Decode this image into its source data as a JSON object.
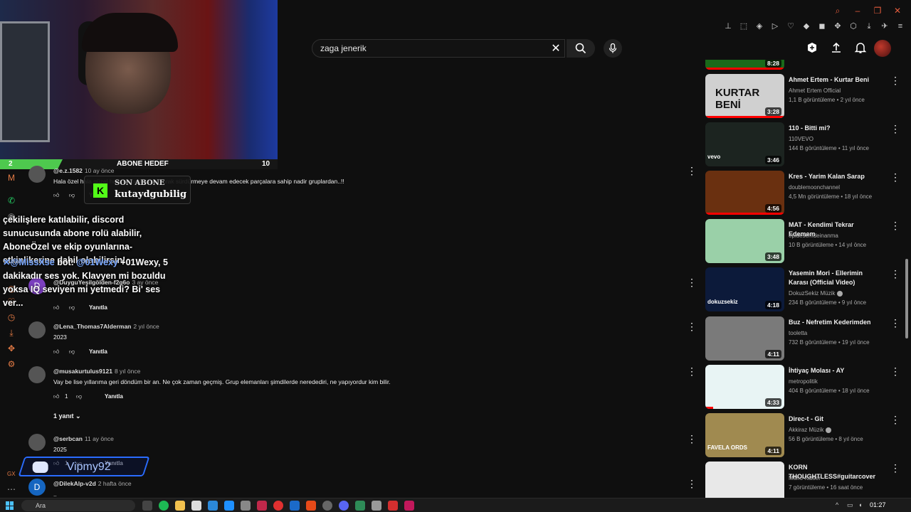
{
  "search": {
    "query": "zaga jenerik"
  },
  "webcam": {
    "sub_goal_title": "ABONE HEDEF",
    "sub_goal_current": "2",
    "sub_goal_target": "10",
    "sub_goal_progress": 0.2
  },
  "last_sub": {
    "label": "SON ABONE",
    "name": "kutaydgubilig"
  },
  "bot": {
    "announcement": "çekilişlere katılabilir, discord sunucusunda abone rolü alabilir, AboneÖzel ve ekip oyunlarına-etkinlikerine dahil olabilirsin!",
    "mention": "@MissXse",
    "sep": "bot:",
    "mention2": "@01Wexy",
    "rest": " +01Wexy, 5 dakikadır ses yok. Klavyen mi bozuldu yoksa IQ seviyen mi yetmedi? Bi' ses ver..."
  },
  "comments": [
    {
      "author": "@e.z.1582",
      "when": "10 ay önce",
      "text": "Hala özel hala güzel hala kalitesini koruyarak sürdürmeye devam edecek parçalara sahip nadir gruplardan..!!",
      "likes": "",
      "reply_label": "Yanıtla",
      "avatar": ""
    },
    {
      "author": "@DuyguYeşilgölden-f2g6o",
      "when": "3 ay önce",
      "text": "",
      "likes": "",
      "reply_label": "Yanıtla",
      "avatar": "D"
    },
    {
      "author": "@Lena_Thomas7Alderman",
      "when": "2 yıl önce",
      "text": "2023",
      "likes": "",
      "reply_label": "Yanıtla",
      "avatar": ""
    },
    {
      "author": "@musakurtulus9121",
      "when": "8 yıl önce",
      "text": "Vay be lise yıllarıma geri döndüm bir an. Ne çok zaman geçmiş. Grup elemanları şimdilerde neredediri, ne yapıyordur kim bilir.",
      "likes": "1",
      "reply_label": "Yanıtla",
      "avatar": ""
    },
    {
      "author": "@serbcan",
      "when": "11 ay önce",
      "text": "2025",
      "likes": "1",
      "reply_label": "Yanıtla",
      "avatar": ""
    },
    {
      "author": "@DilekAlp-v2d",
      "when": "2 hafta önce",
      "text": "..",
      "likes": "",
      "reply_label": "",
      "avatar": "D"
    }
  ],
  "replies_toggle": "1 yanıt",
  "sidebar": [
    {
      "title": "",
      "channel": "",
      "stats": "",
      "duration": "8:28",
      "progress": 1.0,
      "thumb": "#1a6a1a"
    },
    {
      "title": "Ahmet Ertem - Kurtar Beni",
      "channel": "Ahmet Ertem Official",
      "stats": "1,1 B görüntüleme • 2 yıl önce",
      "duration": "3:28",
      "progress": 1.0,
      "thumb": "#d0d0d0",
      "thumb_text": "KURTAR BENİ"
    },
    {
      "title": "110 - Bitti mi?",
      "channel": "110VEVO",
      "stats": "144 B görüntüleme • 11 yıl önce",
      "duration": "3:46",
      "progress": 0,
      "thumb": "#1c2420",
      "thumb_text": "vevo"
    },
    {
      "title": "Kres - Yarim Kalan Sarap",
      "channel": "doublemoonchannel",
      "stats": "4,5 Mn görüntüleme • 18 yıl önce",
      "duration": "4:56",
      "progress": 1.0,
      "thumb": "#6a3010"
    },
    {
      "title": "MAT - Kendimi Tekrar Edemem",
      "channel": "epidesemdeinanma",
      "stats": "10 B görüntüleme • 14 yıl önce",
      "duration": "3:48",
      "progress": 0,
      "thumb": "#9ad0a8"
    },
    {
      "title": "Yasemin Mori - Ellerimin Karası (Official Video)",
      "channel": "DokuzSekiz Müzik",
      "verified": true,
      "stats": "234 B görüntüleme • 9 yıl önce",
      "duration": "4:18",
      "progress": 0,
      "thumb": "#0c1a3a",
      "thumb_text": "dokuzsekiz"
    },
    {
      "title": "Buz - Nefretim Kederimden",
      "channel": "tooletta",
      "stats": "732 B görüntüleme • 19 yıl önce",
      "duration": "4:11",
      "progress": 0,
      "thumb": "#7a7a7a"
    },
    {
      "title": "İhtiyaç Molası - AY",
      "channel": "metropolitik",
      "stats": "404 B görüntüleme • 18 yıl önce",
      "duration": "4:33",
      "progress": 0.1,
      "thumb": "#e8f4f4"
    },
    {
      "title": "Direc-t - Git",
      "channel": "Akkiraz Müzik",
      "verified": true,
      "stats": "56 B görüntüleme • 8 yıl önce",
      "duration": "4:11",
      "progress": 0,
      "thumb": "#a08a50",
      "thumb_text": "FAVELA ORDS"
    },
    {
      "title": "KORN THOUGHTLESS#guitarcover",
      "channel": "Mario Kaiser",
      "stats": "7 görüntüleme • 16 saat önce",
      "duration": "",
      "progress": 0,
      "thumb": "#e8e8e8"
    }
  ],
  "discord": {
    "name": "Vipmy92"
  },
  "taskbar": {
    "search_placeholder": "Ara",
    "time": "01:27"
  },
  "browser_label": "GX",
  "accent": "#ff0000",
  "kick_green": "#53fc18"
}
